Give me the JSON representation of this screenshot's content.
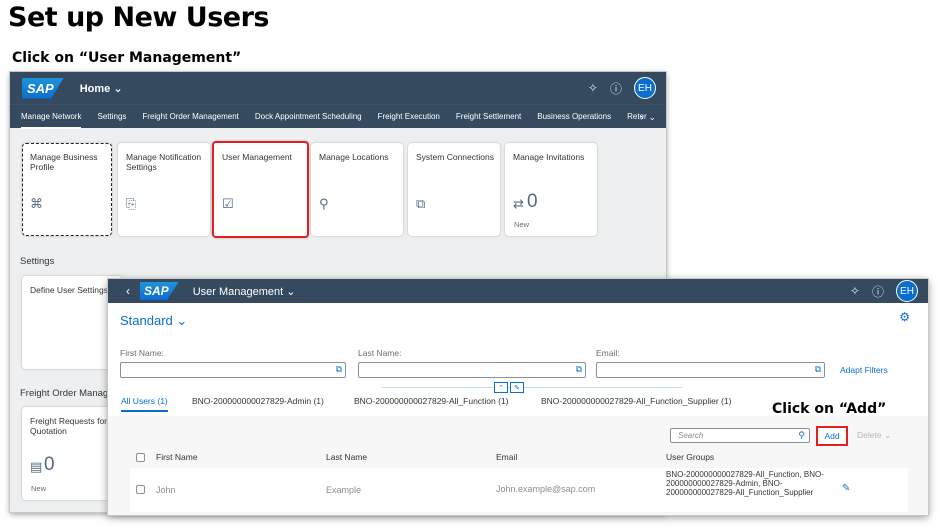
{
  "title": "Set up New Users",
  "instruction": "Click on “User Management”",
  "callout_add": "Click on “Add”",
  "colors": {
    "shell": "#354a5f",
    "accent": "#0a6ed1",
    "highlight": "#e02020"
  },
  "launchpad": {
    "logo": "SAP",
    "home_label": "Home",
    "avatar": "EH",
    "nav_tabs": [
      "Manage Network",
      "Settings",
      "Freight Order Management",
      "Dock Appointment Scheduling",
      "Freight Execution",
      "Freight Settlement",
      "Business Operations",
      "Reter"
    ],
    "tiles": [
      {
        "title": "Manage Business Profile",
        "icon": "person-card-icon"
      },
      {
        "title": "Manage Notification Settings",
        "icon": "doc-search-icon"
      },
      {
        "title": "User Management",
        "icon": "clipboard-check-icon"
      },
      {
        "title": "Manage Locations",
        "icon": "location-pin-icon"
      },
      {
        "title": "System Connections",
        "icon": "connections-icon"
      },
      {
        "title": "Manage Invitations",
        "icon": "people-exchange-icon",
        "count": "0",
        "footer": "New"
      }
    ],
    "settings_section": "Settings",
    "settings_tile": "Define User Settings",
    "freight_section": "Freight Order Manage",
    "freight_tile": {
      "title": "Freight Requests for Quotation",
      "count": "0",
      "footer": "New"
    }
  },
  "user_mgmt": {
    "logo": "SAP",
    "app_title": "User Management",
    "avatar": "EH",
    "variant": "Standard",
    "filters": [
      {
        "label": "First Name:",
        "value": ""
      },
      {
        "label": "Last Name:",
        "value": ""
      },
      {
        "label": "Email:",
        "value": ""
      }
    ],
    "adapt_filters": "Adapt Filters",
    "tabs": [
      "All Users (1)",
      "BNO-200000000027829-Admin (1)",
      "BNO-200000000027829-All_Function (1)",
      "BNO-200000000027829-All_Function_Supplier (1)"
    ],
    "search_placeholder": "Search",
    "add_label": "Add",
    "delete_label": "Delete",
    "columns": [
      "First Name",
      "Last Name",
      "Email",
      "User Groups"
    ],
    "rows": [
      {
        "first": "John",
        "last": "Example",
        "email": "John.example@sap.com",
        "groups": "BNO-200000000027829-All_Function, BNO-200000000027829-Admin, BNO-200000000027829-All_Function_Supplier"
      }
    ]
  }
}
